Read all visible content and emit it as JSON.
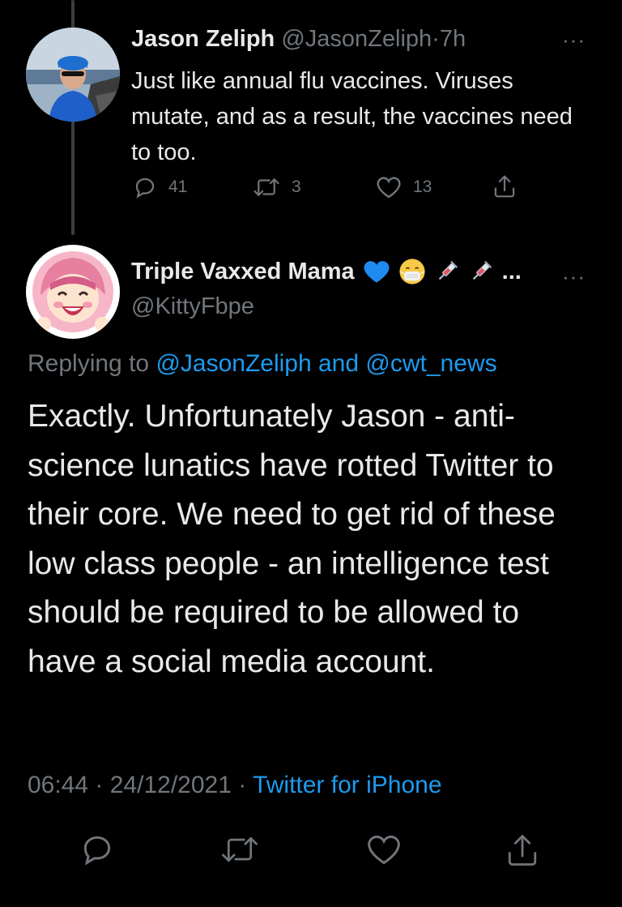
{
  "tweet1": {
    "display_name": "Jason Zeliph",
    "handle": "@JasonZeliph",
    "separator": "·",
    "time": "7h",
    "text": "Just like annual flu vaccines. Viruses mutate, and as a result, the vaccines need to too.",
    "replies": "41",
    "retweets": "3",
    "likes": "13",
    "more": "···"
  },
  "tweet2": {
    "display_name": "Triple Vaxxed Mama",
    "name_emojis": "💙😷💉💉",
    "name_ellipsis": "...",
    "handle": "@KittyFbpe",
    "more": "···",
    "replying_prefix": "Replying to",
    "replying_user1": "@JasonZeliph",
    "replying_and": "and",
    "replying_user2": "@cwt_news",
    "text": "Exactly. Unfortunately Jason - anti-science lunatics have rotted Twitter to their core. We need to get rid of these low class people - an intelligence test should be required to be allowed to have a social media account.",
    "time": "06:44",
    "dot": "·",
    "date": "24/12/2021",
    "dot2": "·",
    "source": "Twitter for iPhone"
  },
  "icons": [
    "reply-icon",
    "retweet-icon",
    "like-icon",
    "share-icon",
    "more-icon",
    "blue-heart-emoji",
    "mask-emoji",
    "syringe-emoji"
  ],
  "colors": {
    "background": "#000000",
    "text": "#e7e9ea",
    "muted": "#71767b",
    "link": "#1d9bf0",
    "heart": "#1d8bf0"
  }
}
